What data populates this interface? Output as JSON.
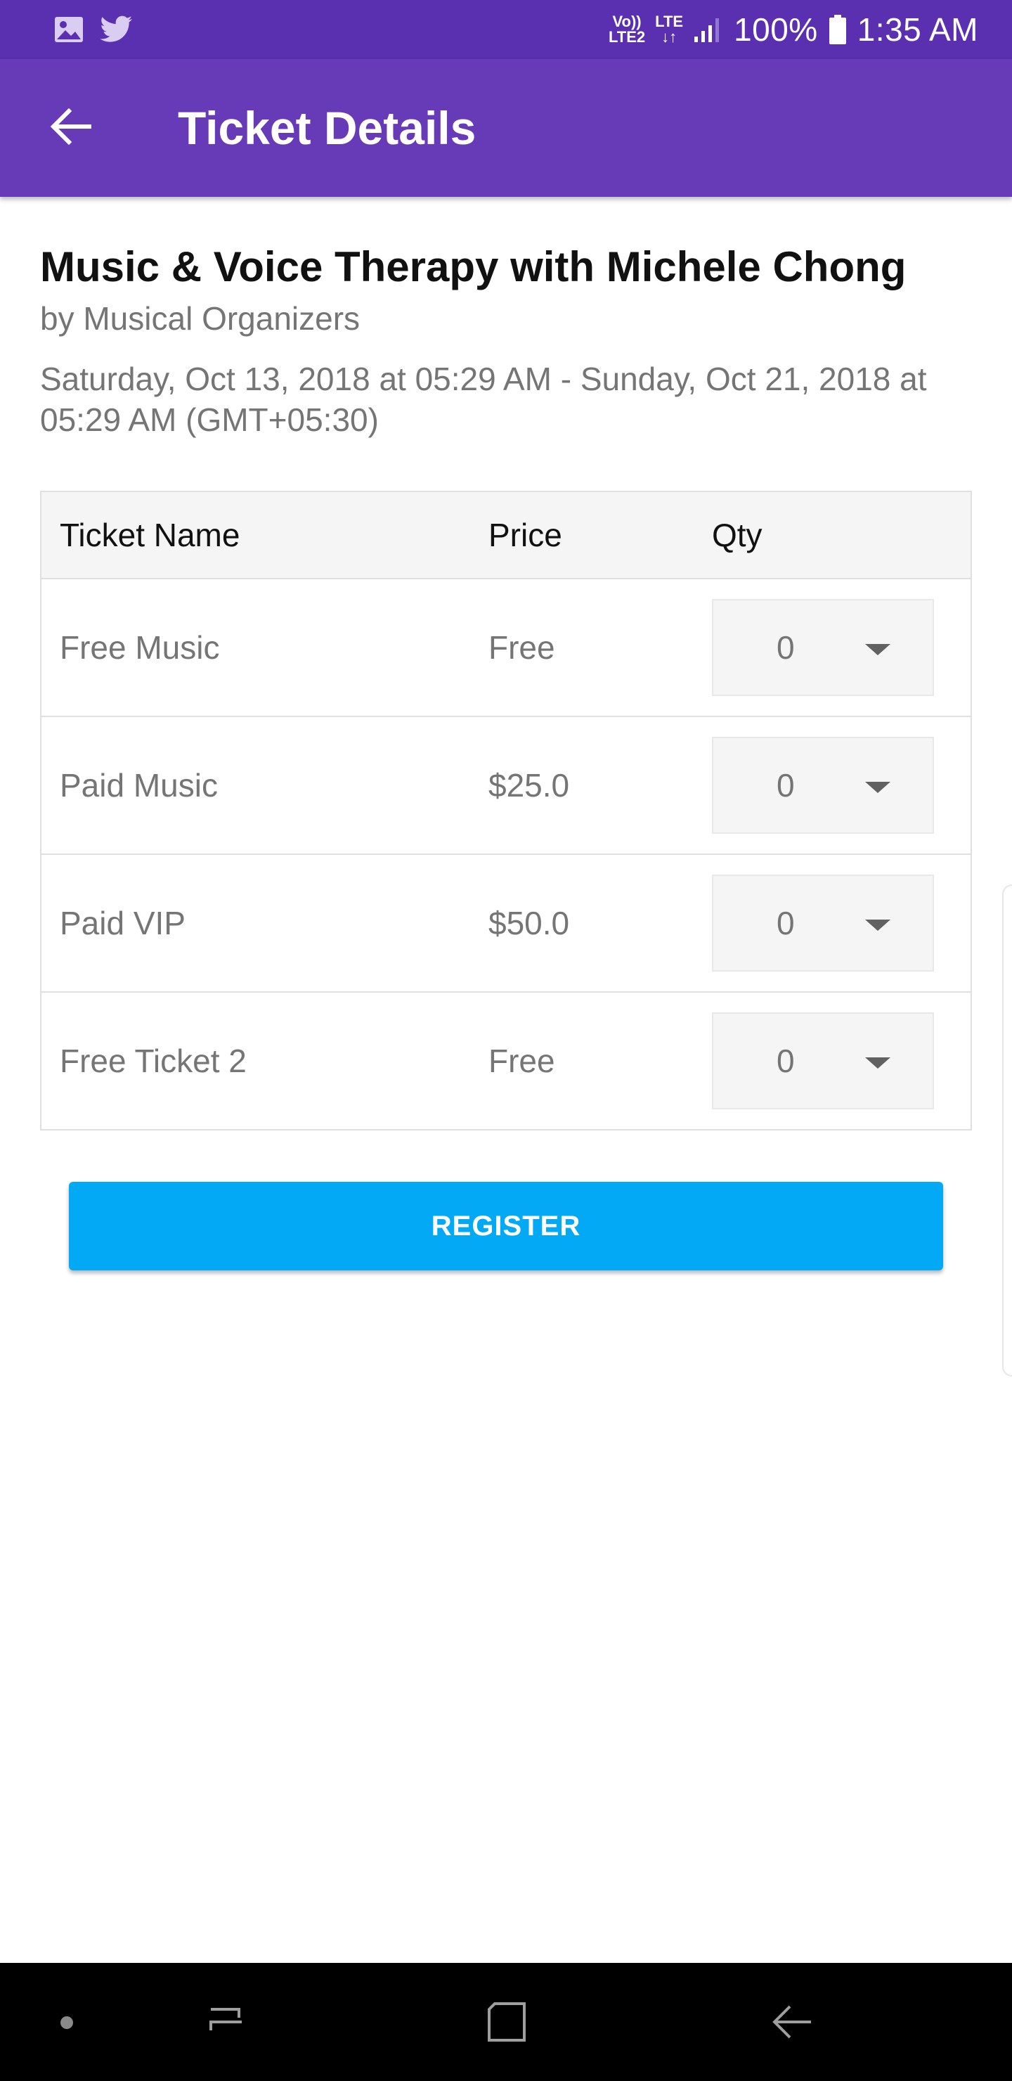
{
  "status_bar": {
    "icons": [
      "image-icon",
      "twitter-icon",
      "volte-icon",
      "lte-icon",
      "signal-icon",
      "battery-icon"
    ],
    "volte_top": "Vo))",
    "volte_bottom": "LTE2",
    "lte_label": "LTE",
    "battery_percent": "100%",
    "time": "1:35 AM",
    "background_color": "#5a2fb0"
  },
  "app_bar": {
    "title": "Ticket Details",
    "back_icon": "arrow-left-icon",
    "background_color": "#673ab7"
  },
  "event": {
    "title": "Music & Voice Therapy with Michele Chong",
    "organizer": "by Musical Organizers",
    "dates": "Saturday, Oct 13, 2018 at 05:29 AM - Sunday, Oct 21, 2018 at 05:29 AM (GMT+05:30)"
  },
  "table": {
    "headers": {
      "name": "Ticket Name",
      "price": "Price",
      "qty": "Qty"
    },
    "rows": [
      {
        "name": "Free Music",
        "price": "Free",
        "qty": "0"
      },
      {
        "name": "Paid Music",
        "price": "$25.0",
        "qty": "0"
      },
      {
        "name": "Paid VIP",
        "price": "$50.0",
        "qty": "0"
      },
      {
        "name": "Free Ticket 2",
        "price": "Free",
        "qty": "0"
      }
    ]
  },
  "register_button": {
    "label": "REGISTER",
    "color": "#03a9f4"
  },
  "nav_bar": {
    "icons": [
      "dot-icon",
      "recents-icon",
      "home-icon",
      "back-icon"
    ]
  }
}
